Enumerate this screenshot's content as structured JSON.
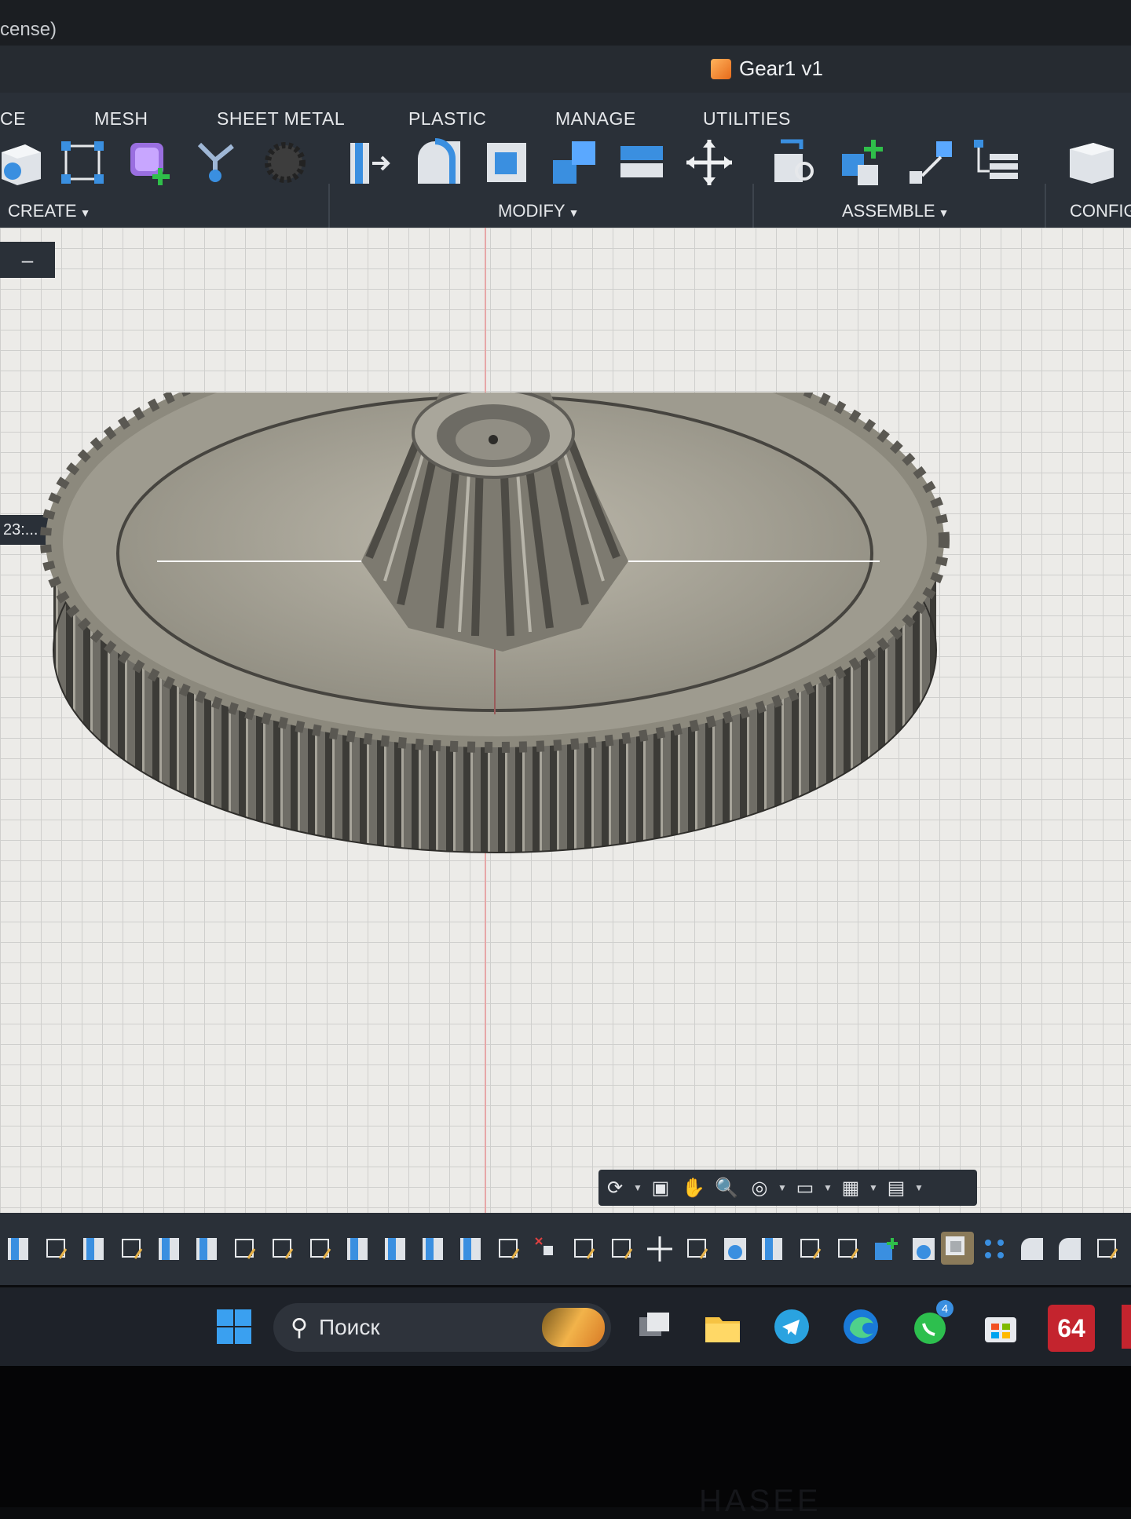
{
  "title_bar": {
    "license_fragment": "cense)"
  },
  "document": {
    "name": "Gear1 v1",
    "icon": "orange-cube-icon"
  },
  "tabs": [
    "CE",
    "MESH",
    "SHEET METAL",
    "PLASTIC",
    "MANAGE",
    "UTILITIES"
  ],
  "groups": {
    "create": "CREATE",
    "modify": "MODIFY",
    "assemble": "ASSEMBLE",
    "configure": "CONFIG"
  },
  "viewport": {
    "mini_button": "–",
    "side_label": "23:..."
  },
  "taskbar": {
    "search_placeholder": "Поиск",
    "badge_whatsapp": "4",
    "app_64_label": "64"
  },
  "bezel": {
    "brand": "HASEE"
  },
  "colors": {
    "toolbar": "#2a3038",
    "accent_blue": "#3a8fe0",
    "taskbar": "#1e2229",
    "gear": "#8a877c"
  }
}
